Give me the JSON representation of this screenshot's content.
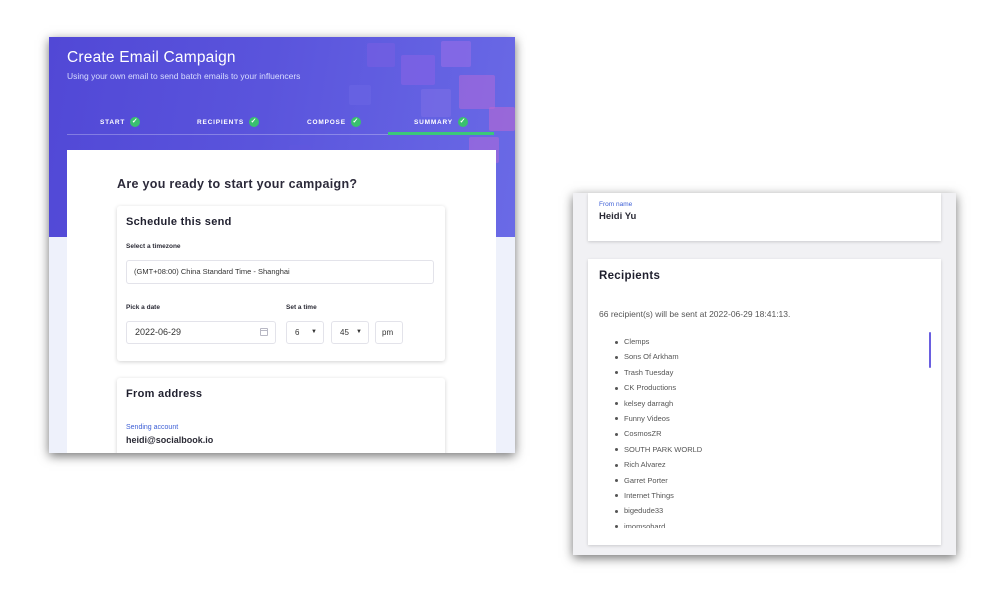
{
  "campaign": {
    "title": "Create Email Campaign",
    "subtitle": "Using your own email to send batch emails to your influencers",
    "steps": [
      {
        "label": "START",
        "done": true
      },
      {
        "label": "RECIPIENTS",
        "done": true
      },
      {
        "label": "COMPOSE",
        "done": true
      },
      {
        "label": "SUMMARY",
        "done": true,
        "active": true
      }
    ],
    "check_glyph": "✓",
    "accent": "#5148d6",
    "success": "#39c06f"
  },
  "summary": {
    "question": "Are you ready to start your campaign?",
    "schedule": {
      "title": "Schedule this send",
      "timezone_label": "Select a timezone",
      "timezone_value": "(GMT+08:00) China Standard Time - Shanghai",
      "date_label": "Pick a date",
      "date_value": "2022-06-29",
      "time_label": "Set a time",
      "hour": "6",
      "minute": "45",
      "ampm": "pm",
      "caret": "▼"
    },
    "from": {
      "title": "From address",
      "sending_label": "Sending account",
      "sending_value": "heidi@socialbook.io"
    }
  },
  "detail": {
    "from_name_label": "From name",
    "from_name_value": "Heidi Yu",
    "recipients_title": "Recipients",
    "recipients_summary": "66 recipient(s) will be sent at 2022-06-29 18:41:13.",
    "recipients": [
      "Clemps",
      "Sons Of Arkham",
      "Trash Tuesday",
      "CK Productions",
      "kelsey darragh",
      "Funny Videos",
      "CosmosZR",
      "SOUTH PARK WORLD",
      "Rich Alvarez",
      "Garret Porter",
      "Internet Things",
      "bigedude33",
      "imomsohard"
    ]
  }
}
